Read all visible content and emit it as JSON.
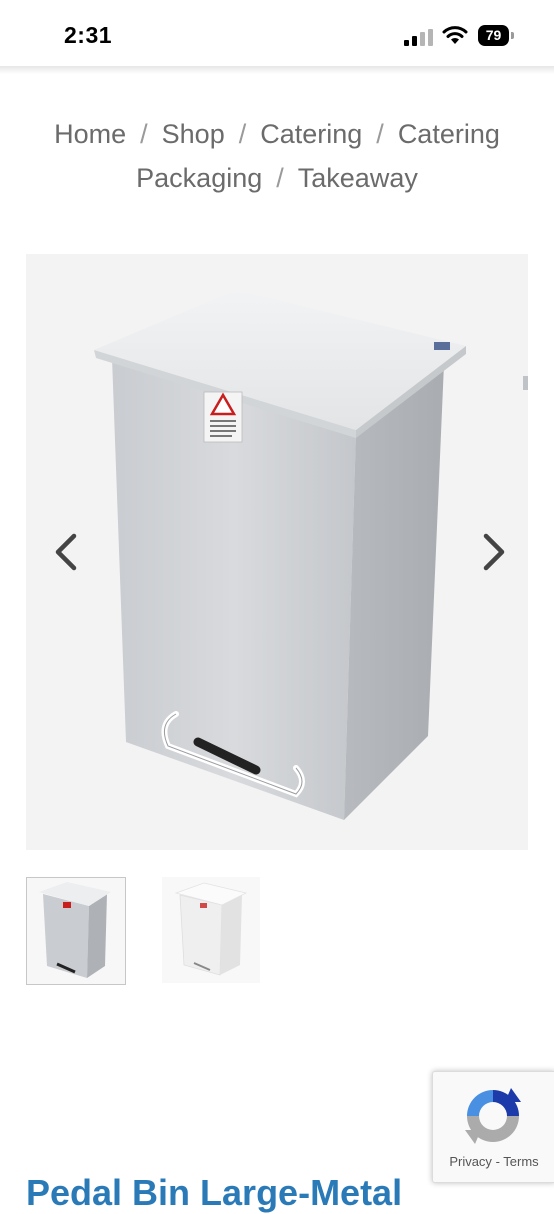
{
  "status_bar": {
    "time": "2:31",
    "battery": "79"
  },
  "breadcrumb": {
    "items": [
      "Home",
      "Shop",
      "Catering",
      "Catering Packaging",
      "Takeaway"
    ],
    "separator": "/"
  },
  "gallery": {
    "prev_icon": "chevron-left-icon",
    "next_icon": "chevron-right-icon",
    "thumbnails": 2,
    "selected_thumbnail": 1
  },
  "product": {
    "title": "Pedal Bin Large-Metal"
  },
  "recaptcha": {
    "privacy": "Privacy",
    "dash": "-",
    "terms": "Terms"
  },
  "colors": {
    "title": "#2b7ab8",
    "breadcrumb": "#6b6b6b"
  }
}
